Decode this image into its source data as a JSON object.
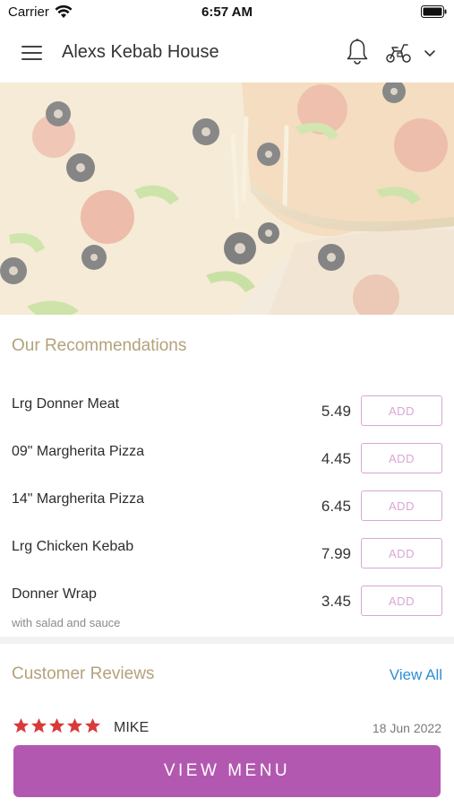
{
  "status_bar": {
    "carrier": "Carrier",
    "time": "6:57 AM"
  },
  "header": {
    "title": "Alexs Kebab House"
  },
  "icons": {
    "menu": "hamburger-menu-icon",
    "notifications": "bell-icon",
    "order_type": "scooter-icon",
    "dropdown": "chevron-down-icon",
    "rating": "star-icon"
  },
  "recommendations": {
    "title": "Our Recommendations",
    "items": [
      {
        "name": "Lrg Donner Meat",
        "description": "",
        "price": "5.49",
        "button": "ADD"
      },
      {
        "name": "09\" Margherita Pizza",
        "description": "",
        "price": "4.45",
        "button": "ADD"
      },
      {
        "name": "14\" Margherita Pizza",
        "description": "",
        "price": "6.45",
        "button": "ADD"
      },
      {
        "name": "Lrg Chicken Kebab",
        "description": "",
        "price": "7.99",
        "button": "ADD"
      },
      {
        "name": "Donner Wrap",
        "description": "with salad and sauce",
        "price": "3.45",
        "button": "ADD"
      }
    ]
  },
  "reviews": {
    "title": "Customer Reviews",
    "view_all": "View All",
    "items": [
      {
        "name": "MIKE",
        "date": "18 Jun 2022",
        "rating": 5
      }
    ]
  },
  "footer": {
    "view_menu": "VIEW MENU"
  },
  "colors": {
    "accent": "#b358b0",
    "add_button": "#d9a6d6",
    "section_title": "#b3a27c",
    "link": "#2f8fd3",
    "star": "#d83a3a"
  }
}
